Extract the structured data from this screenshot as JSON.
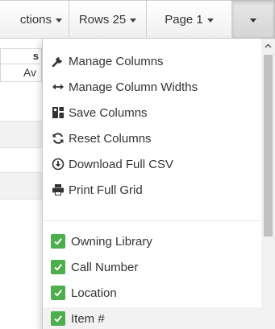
{
  "toolbar": {
    "actions_label": "ctions",
    "rows_label": "Rows 25",
    "page_label": "Page 1"
  },
  "grid": {
    "header_fragment": "s",
    "subheader_fragment": "Av"
  },
  "menu": {
    "actions": [
      {
        "label": "Manage Columns",
        "icon": "wrench-icon"
      },
      {
        "label": "Manage Column Widths",
        "icon": "left-right-arrow-icon"
      },
      {
        "label": "Save Columns",
        "icon": "save-columns-icon"
      },
      {
        "label": "Reset Columns",
        "icon": "refresh-icon"
      },
      {
        "label": "Download Full CSV",
        "icon": "download-icon"
      },
      {
        "label": "Print Full Grid",
        "icon": "print-icon"
      }
    ],
    "columns": [
      {
        "label": "Owning Library",
        "checked": true
      },
      {
        "label": "Call Number",
        "checked": true
      },
      {
        "label": "Location",
        "checked": true
      },
      {
        "label": "Item #",
        "checked": true
      }
    ]
  },
  "colors": {
    "checkbox_green": "#4cae4c",
    "highlight_row": "#f2f2f2"
  }
}
